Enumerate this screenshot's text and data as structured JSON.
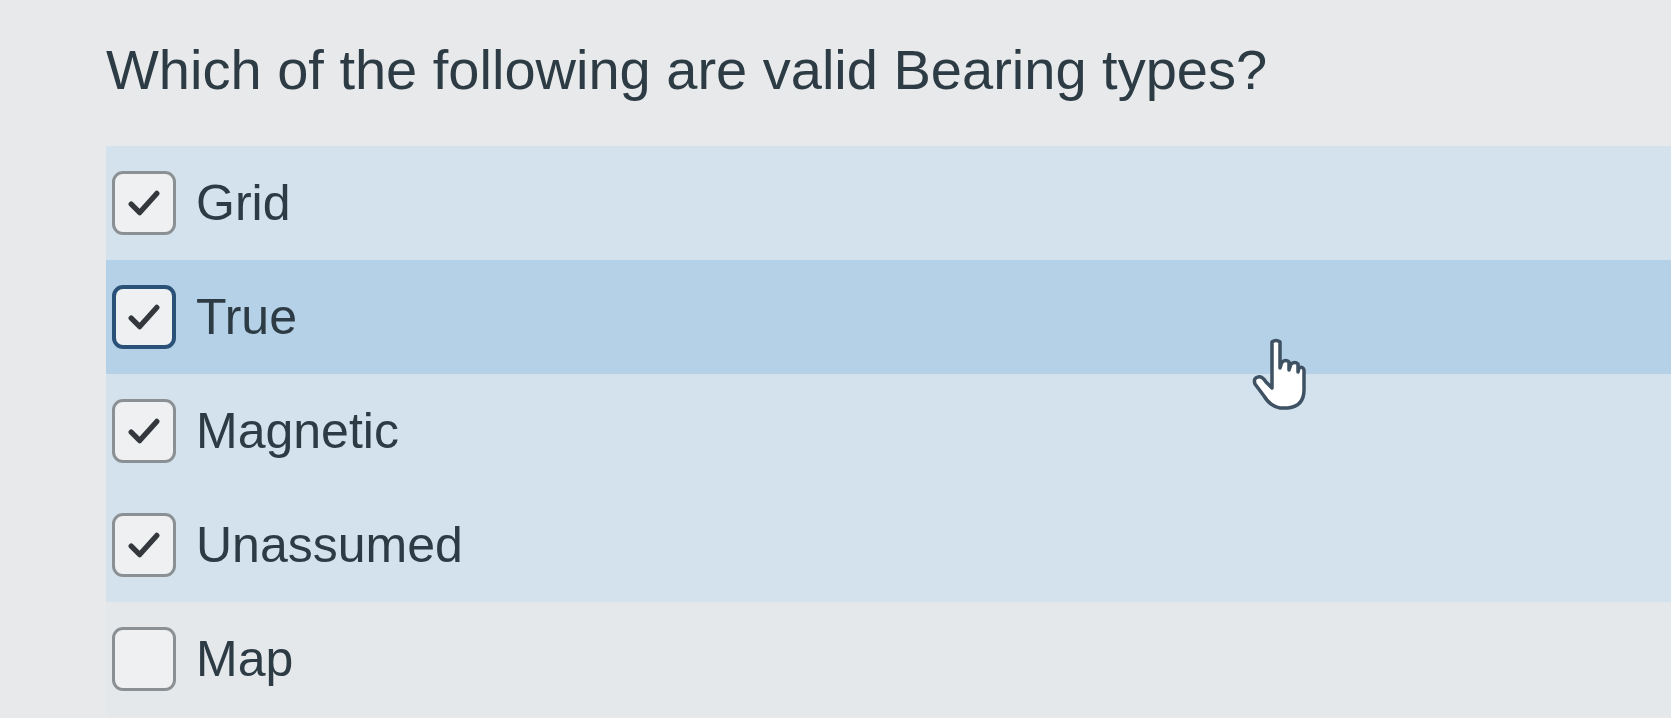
{
  "question": {
    "text": "Which of the following are valid Bearing types?"
  },
  "options": [
    {
      "label": "Grid",
      "checked": true,
      "hovered": false
    },
    {
      "label": "True",
      "checked": true,
      "hovered": true
    },
    {
      "label": "Magnetic",
      "checked": true,
      "hovered": false
    },
    {
      "label": "Unassumed",
      "checked": true,
      "hovered": false
    },
    {
      "label": "Map",
      "checked": false,
      "hovered": false
    }
  ]
}
